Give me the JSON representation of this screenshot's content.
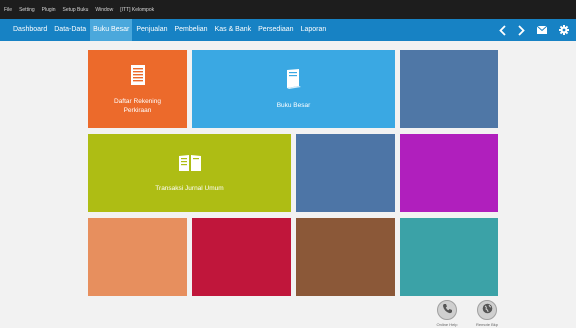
{
  "menubar": {
    "items": [
      "File",
      "Setting",
      "Plugin",
      "Setup Buku",
      "Window",
      "[ITT] Kelompok"
    ]
  },
  "nav": {
    "tabs": [
      "Dashboard",
      "Data-Data",
      "Buku Besar",
      "Penjualan",
      "Pembelian",
      "Kas & Bank",
      "Persediaan",
      "Laporan"
    ],
    "active_tab": "Buku Besar"
  },
  "tiles": {
    "daftar_rekening": {
      "label": "Daftar Rekening Perkiraan",
      "color": "#ec6a2b"
    },
    "buku_besar": {
      "label": "Buku Besar",
      "color": "#3aa8e3"
    },
    "transaksi_jurnal": {
      "label": "Transaksi Jurnal Umum",
      "color": "#aebd14"
    },
    "colors": {
      "steel_top": "#4f77a6",
      "steel_mid": "#4d75a6",
      "purple": "#b01fbd",
      "salmon": "#e78f5e",
      "crimson": "#c0163b",
      "brown": "#8b5838",
      "teal": "#3ba2a7"
    }
  },
  "footer": {
    "left_label": "Online Help",
    "right_label": "Remote Bkp"
  }
}
